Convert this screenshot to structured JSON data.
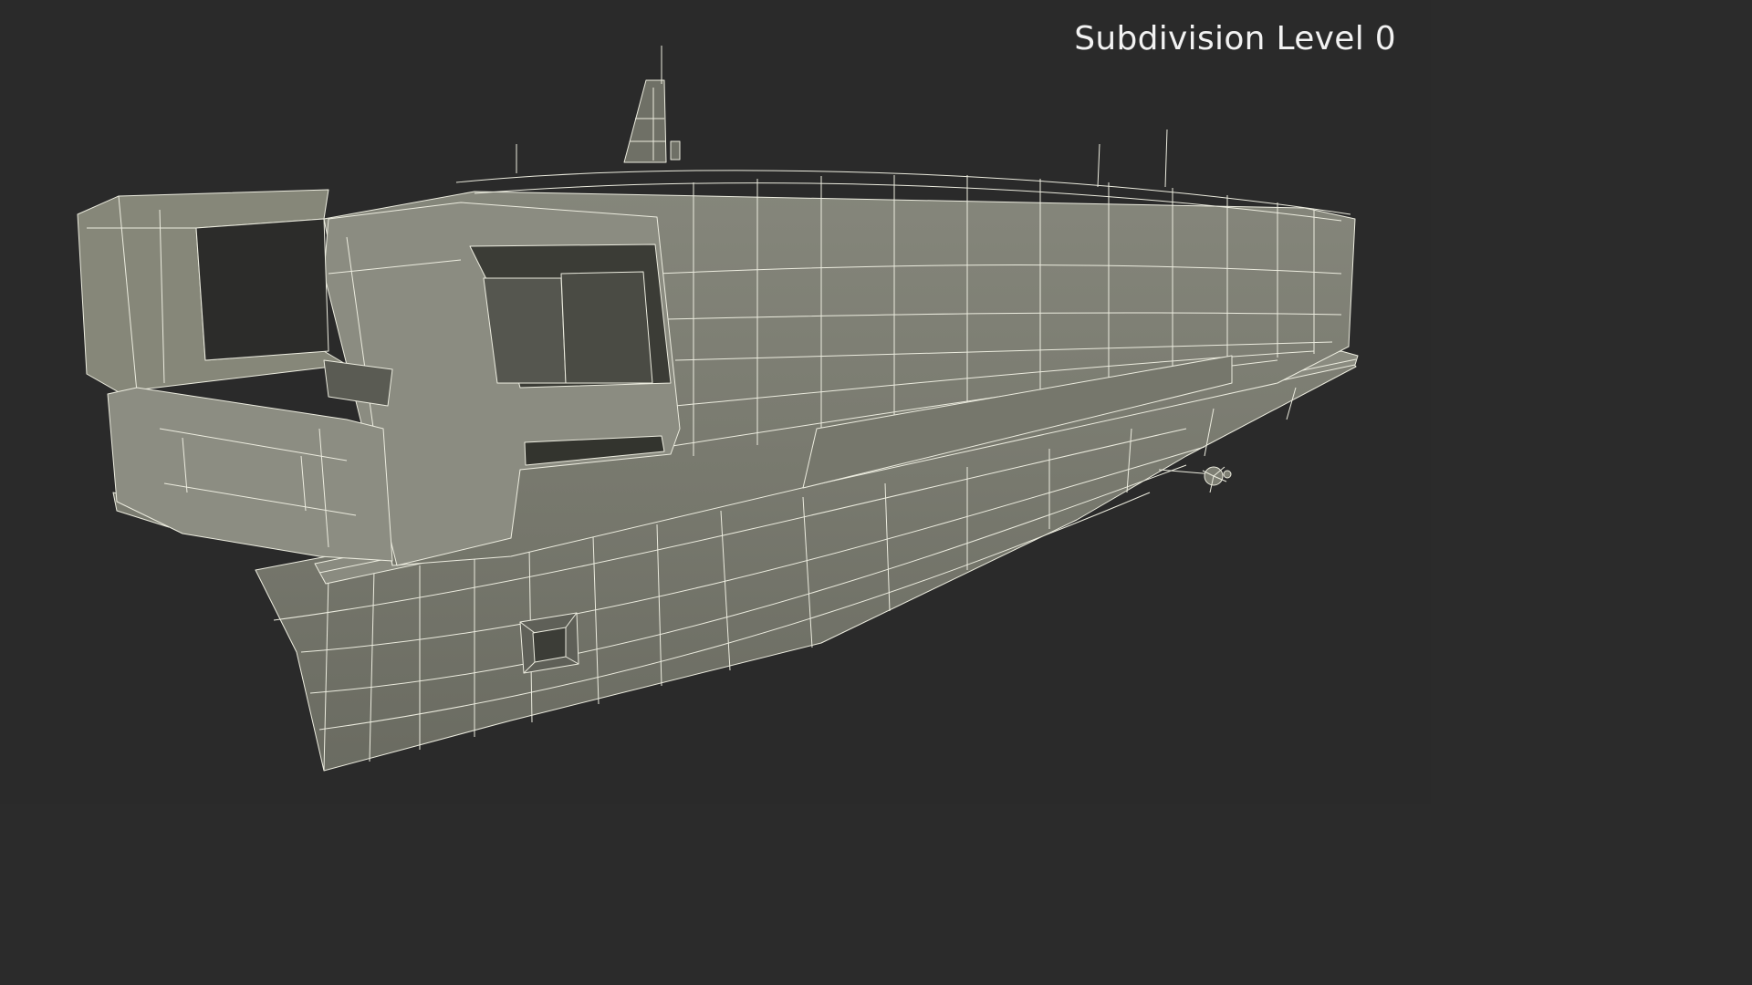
{
  "viewport": {
    "subdivision_label": "Subdivision Level 0",
    "background_color": "#2a2a2a",
    "model_fill_color": "#7c7d72",
    "wire_color": "#ececdf"
  },
  "model": {
    "icon_name": "boat-wireframe-model"
  }
}
